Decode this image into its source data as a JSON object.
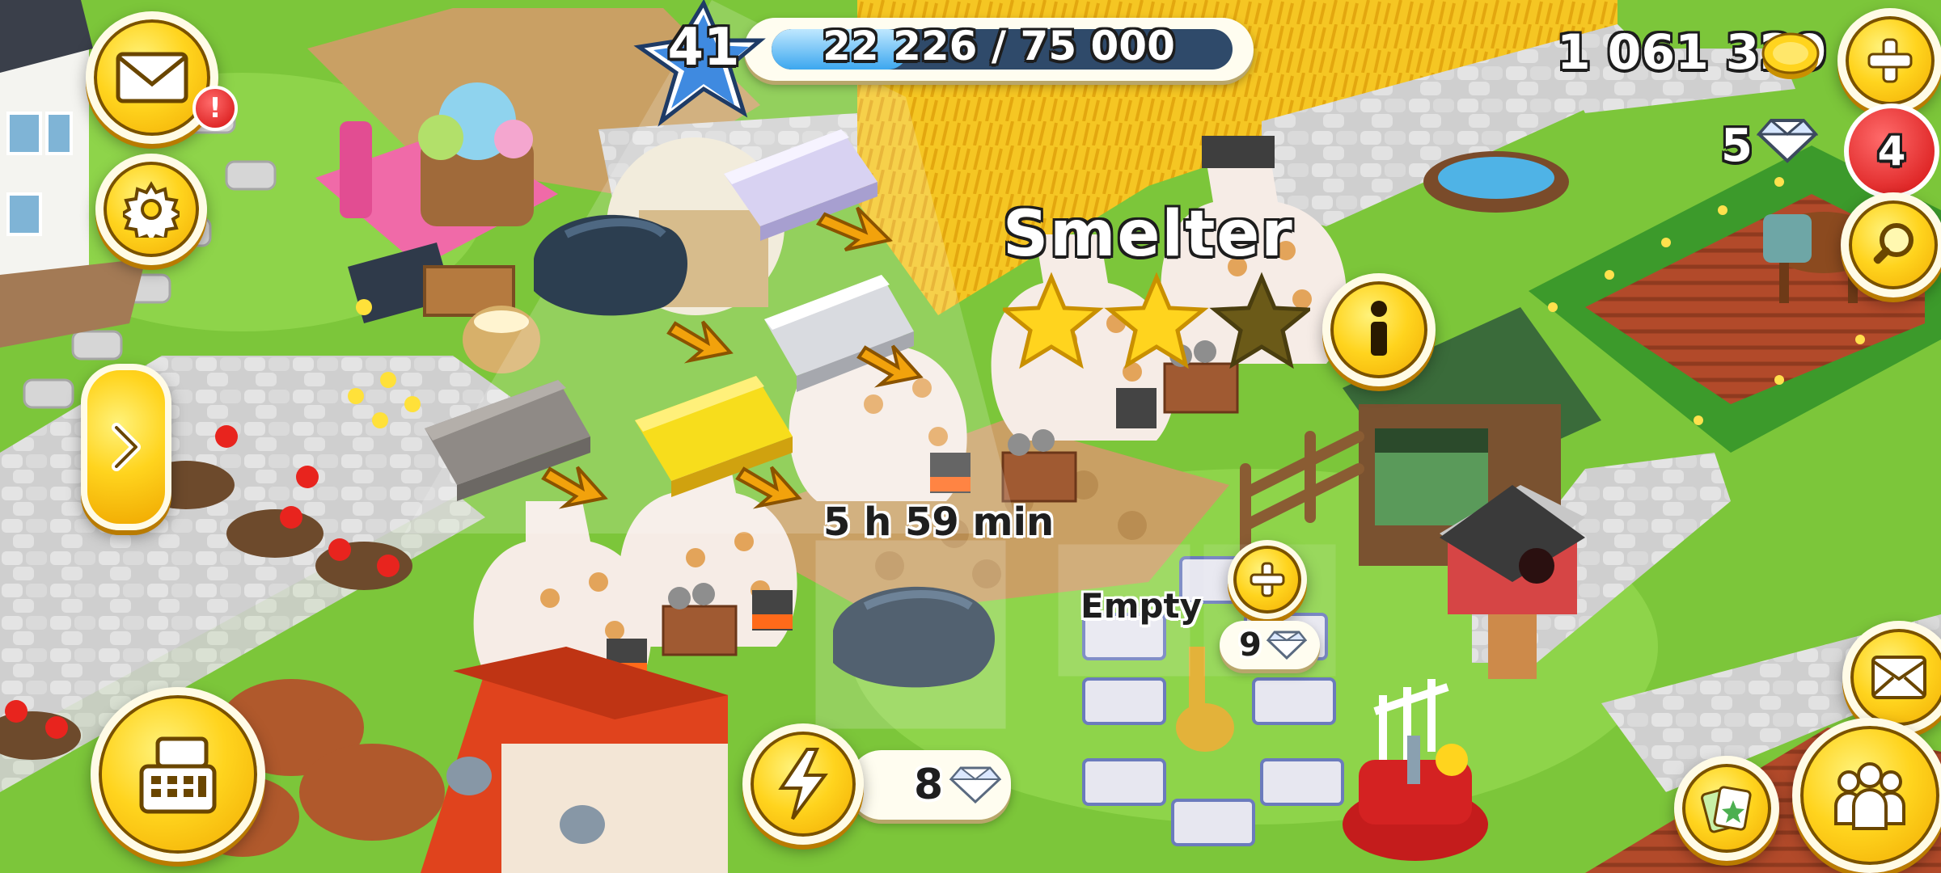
{
  "hud": {
    "level": "41",
    "xp_text": "22 226 / 75 000",
    "xp_progress": 0.2964,
    "coins": "1 061 329",
    "diamonds": "5",
    "mail_alert": "!",
    "notification_count": "4"
  },
  "building": {
    "title": "Smelter",
    "stars_filled": 2,
    "stars_total": 3,
    "timer": "5 h 59 min",
    "slot_label": "Empty",
    "unlock_cost": "9",
    "speedup_cost": "8"
  },
  "colors": {
    "gold": "#ffd41e",
    "xp_fill": "#3ca7ef",
    "alert_red": "#d40f0f",
    "grass": "#7cc63a",
    "wheat": "#f5c623"
  }
}
